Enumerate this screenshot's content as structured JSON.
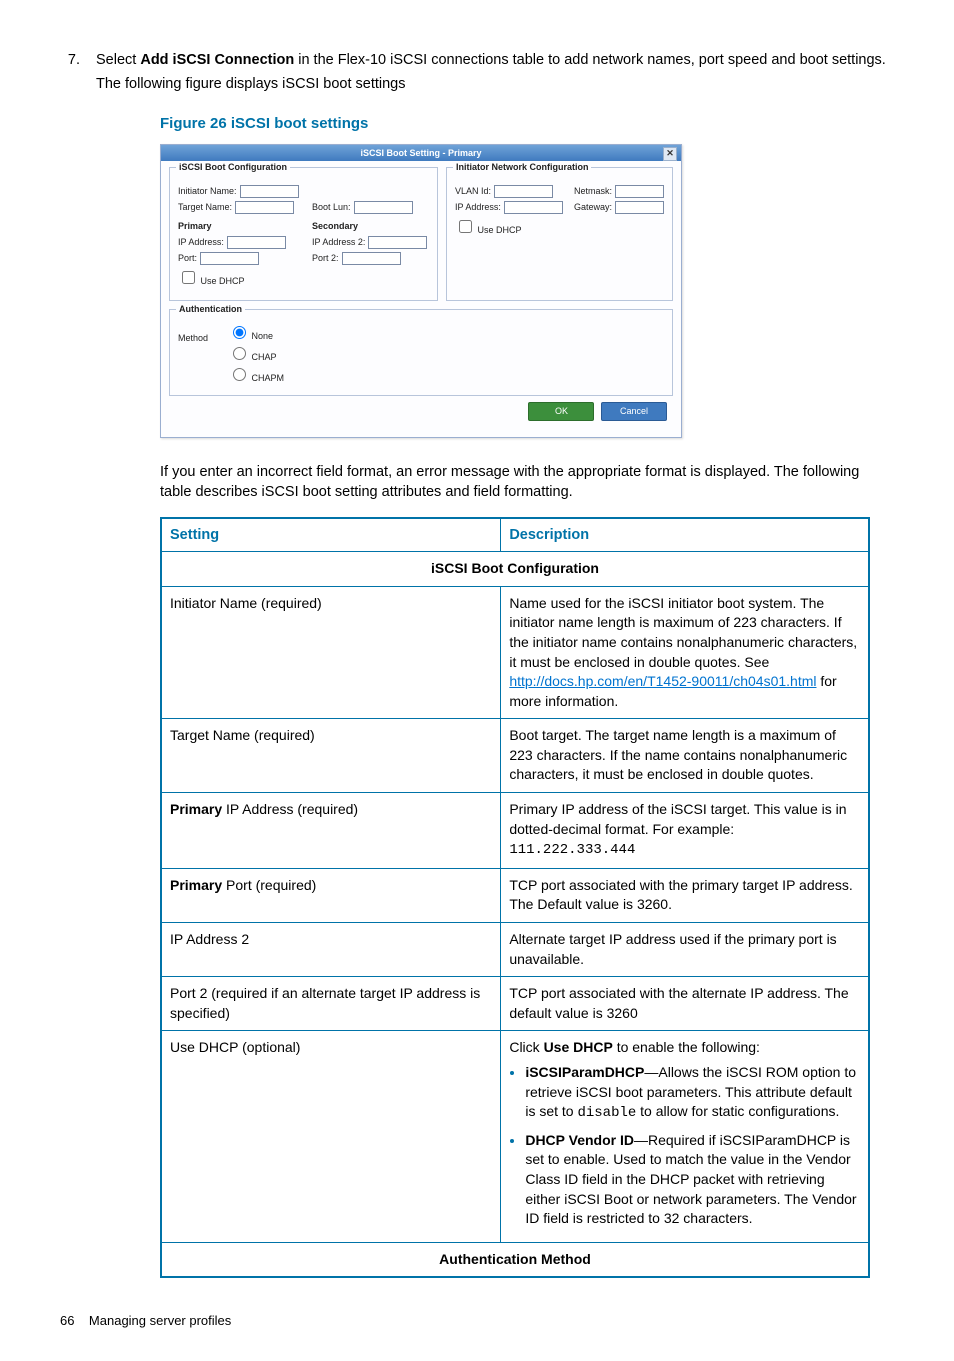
{
  "step": {
    "number": "7.",
    "lead_pre": "Select ",
    "lead_bold": "Add iSCSI Connection",
    "lead_post": " in the Flex-10 iSCSI connections table to add network names, port speed and boot settings.",
    "line2": "The following figure displays iSCSI boot settings"
  },
  "figure_title": "Figure 26 iSCSI boot settings",
  "dialog": {
    "title": "iSCSI Boot Setting - Primary",
    "close": "✕",
    "boot_cfg_legend": "iSCSI Boot Configuration",
    "net_cfg_legend": "Initiator Network Configuration",
    "labels": {
      "initiator_name": "Initiator Name:",
      "target_name": "Target Name:",
      "primary": "Primary",
      "secondary": "Secondary",
      "ip_address": "IP Address:",
      "boot_lun": "Boot Lun:",
      "ip_address_2": "IP Address 2:",
      "port": "Port:",
      "port2": "Port 2:",
      "use_dhcp": "Use DHCP",
      "vlan_id": "VLAN Id:",
      "netmask": "Netmask:",
      "gateway": "Gateway:"
    },
    "auth": {
      "legend": "Authentication",
      "method_label": "Method",
      "none": "None",
      "chap": "CHAP",
      "chapm": "CHAPM"
    },
    "ok": "OK",
    "cancel": "Cancel"
  },
  "para_after": "If you enter an incorrect field format, an error message with the appropriate format is displayed. The following table describes iSCSI boot setting attributes and field formatting.",
  "table": {
    "h1": "Setting",
    "h2": "Description",
    "section1": "iSCSI Boot Configuration",
    "rows": [
      {
        "setting": "Initiator Name (required)",
        "desc_pre": "Name used for the iSCSI initiator boot system. The initiator name length is maximum of 223 characters. If the initiator name contains nonalphanumeric characters, it must be enclosed in double quotes. See ",
        "link": "http://docs.hp.com/en/T1452-90011/ch04s01.html",
        "desc_post": " for more information."
      },
      {
        "setting": "Target Name (required)",
        "desc": "Boot target. The target name length is a maximum of 223 characters. If the name contains nonalphanumeric characters, it must be enclosed in double quotes."
      },
      {
        "setting_bold": "Primary",
        "setting_post": " IP Address (required)",
        "desc": "Primary IP address of the iSCSI target. This value is in dotted-decimal format. For example: ",
        "code": "111.222.333.444"
      },
      {
        "setting_bold": "Primary",
        "setting_post": " Port (required)",
        "desc": "TCP port associated with the primary target IP address. The Default value is 3260."
      },
      {
        "setting": "IP Address 2",
        "desc": "Alternate target IP address used if the primary port is unavailable."
      },
      {
        "setting": "Port 2 (required if an alternate target IP address is specified)",
        "desc": "TCP port associated with the alternate IP address. The default value is 3260"
      },
      {
        "setting": "Use DHCP (optional)",
        "desc_pre": "Click ",
        "desc_bold": "Use DHCP",
        "desc_post": " to enable the following:",
        "bul1_bold": "iSCSIParamDHCP",
        "bul1_rest": "—Allows the iSCSI ROM option to retrieve iSCSI boot parameters. This attribute default is set to ",
        "bul1_code": "disable",
        "bul1_end": " to allow for static configurations.",
        "bul2_bold": "DHCP Vendor ID",
        "bul2_rest": "—Required if iSCSIParamDHCP is set to enable. Used to match the value in the Vendor Class ID field in the DHCP packet with retrieving either iSCSI Boot or network parameters. The Vendor ID field is restricted to 32 characters."
      }
    ],
    "section2": "Authentication Method"
  },
  "footer": {
    "page": "66",
    "title": "Managing server profiles"
  }
}
